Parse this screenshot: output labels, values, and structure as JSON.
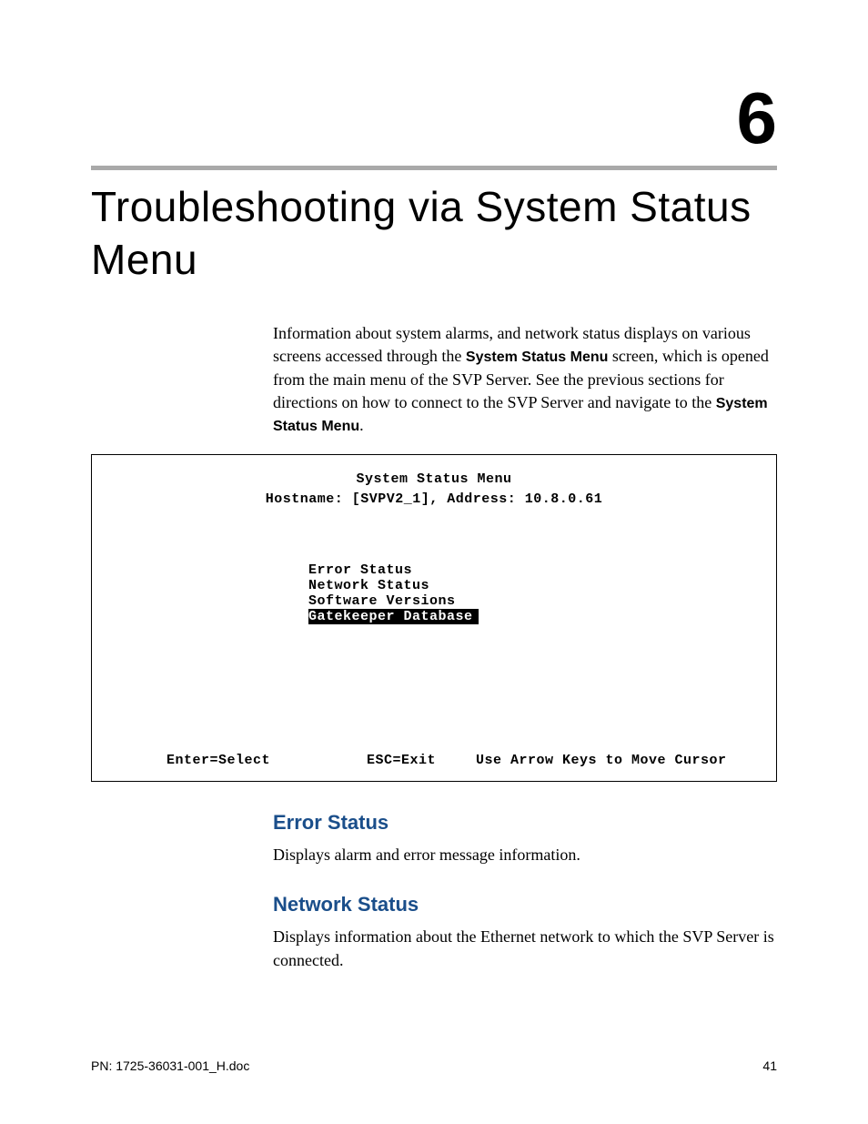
{
  "chapter": {
    "number": "6",
    "title": "Troubleshooting via System Status Menu"
  },
  "intro": {
    "part1": "Information about system alarms, and network status displays on various screens accessed through the ",
    "bold1": "System Status Menu",
    "part2": " screen, which is opened from the main menu of the SVP Server. See the previous sections for directions on how to connect to the SVP Server and navigate to the ",
    "bold2": "System Status Menu",
    "part3": "."
  },
  "terminal": {
    "title": "System Status Menu",
    "hostline": "Hostname: [SVPV2_1], Address: 10.8.0.61",
    "items": {
      "error": "Error Status",
      "network": "Network Status",
      "software": "Software Versions",
      "gatekeeper": "Gatekeeper Database"
    },
    "footer": {
      "enter": "Enter=Select",
      "esc": "ESC=Exit",
      "arrows": "Use Arrow Keys to Move Cursor"
    }
  },
  "sections": {
    "error": {
      "heading": "Error Status",
      "body": "Displays alarm and error message information."
    },
    "network": {
      "heading": "Network Status",
      "body": "Displays information about the Ethernet network to which the SVP Server is connected."
    }
  },
  "footer": {
    "pn": "PN: 1725-36031-001_H.doc",
    "page": "41"
  }
}
